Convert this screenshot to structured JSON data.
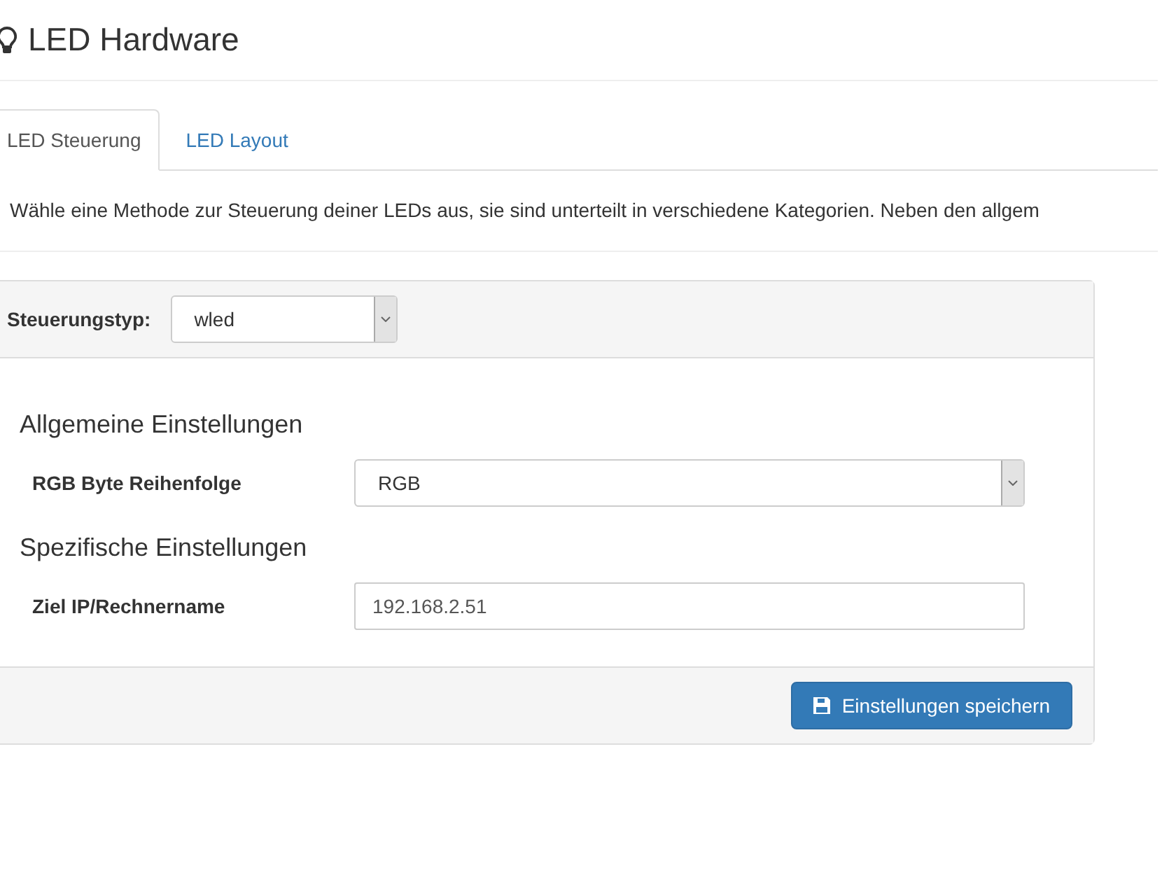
{
  "page": {
    "title": "LED Hardware"
  },
  "tabs": [
    {
      "label": "LED Steuerung",
      "selected": true
    },
    {
      "label": "LED Layout",
      "selected": false
    }
  ],
  "intro": "Wähle eine Methode zur Steuerung deiner LEDs aus, sie sind unterteilt in verschiedene Kategorien. Neben den allgem",
  "panel": {
    "type_label": "Steuerungstyp:",
    "type_value": "wled",
    "sections": [
      {
        "title": "Allgemeine Einstellungen",
        "fields": [
          {
            "kind": "select",
            "label": "RGB Byte Reihenfolge",
            "value": "RGB"
          }
        ]
      },
      {
        "title": "Spezifische Einstellungen",
        "fields": [
          {
            "kind": "text",
            "label": "Ziel IP/Rechnername",
            "value": "192.168.2.51"
          }
        ]
      }
    ],
    "save_button": "Einstellungen speichern"
  }
}
